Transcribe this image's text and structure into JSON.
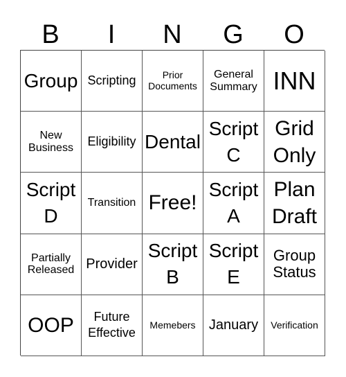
{
  "header": {
    "letters": [
      "B",
      "I",
      "N",
      "G",
      "O"
    ]
  },
  "cells": [
    [
      "Group",
      "Scripting",
      "Prior\nDocuments",
      "General\nSummary",
      "INN"
    ],
    [
      "New\nBusiness",
      "Eligibility",
      "Dental",
      "Script\nC",
      "Grid\nOnly"
    ],
    [
      "Script\nD",
      "Transition",
      "Free!",
      "Script\nA",
      "Plan\nDraft"
    ],
    [
      "Partially\nReleased",
      "Provider",
      "Script\nB",
      "Script\nE",
      "Group\nStatus"
    ],
    [
      "OOP",
      "Future\nEffective",
      "Memebers",
      "January",
      "Verification"
    ]
  ]
}
